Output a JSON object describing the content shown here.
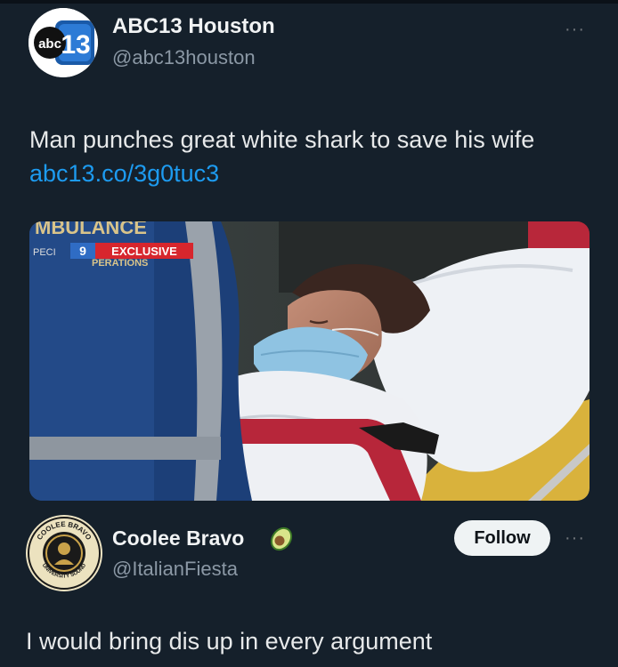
{
  "tweet": {
    "author_name": "ABC13 Houston",
    "author_handle": "@abc13houston",
    "avatar_logo_text": "abc",
    "avatar_logo_number": "13",
    "text": "Man punches great white shark to save his wife ",
    "link": "abc13.co/3g0tuc3",
    "media": {
      "sign_text": "MBULANCE",
      "sign_sub_text": "PERATIONS",
      "sign_left_text": "PECI",
      "channel_badge": "9",
      "exclusive_label": "EXCLUSIVE"
    }
  },
  "reply": {
    "author_name": "Coolee Bravo",
    "author_handle": "@ItalianFiesta",
    "badge_emoji": "avocado-icon",
    "follow_label": "Follow",
    "avatar_ring_top": "COOLEE BRAVO",
    "avatar_ring_bottom": "UNIVERSITY SOUND",
    "text": "I would bring dis up in every argument"
  },
  "more_label": "···",
  "colors": {
    "background": "#15202b",
    "link": "#1d9bf0",
    "abc_blue": "#1a5aa8",
    "exclusive_red": "#d7262d"
  }
}
